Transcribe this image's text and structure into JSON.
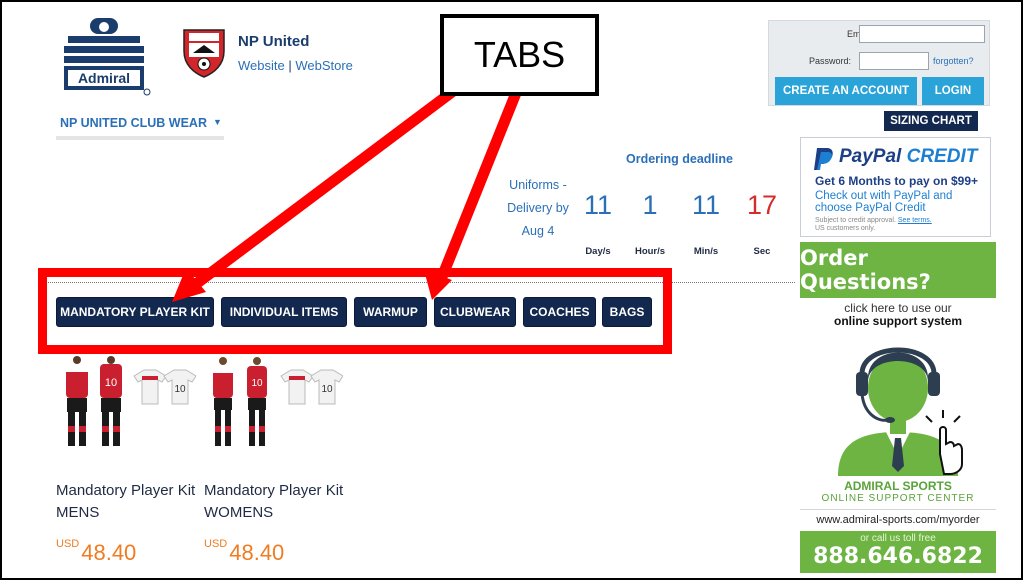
{
  "header": {
    "brand_logo_text": "Admiral",
    "club_name": "NP United",
    "link_website": "Website",
    "link_separator": " | ",
    "link_webstore": "WebStore",
    "club_menu_label": "NP UNITED CLUB WEAR"
  },
  "callout": {
    "label": "TABS",
    "color": "#ff0000"
  },
  "login": {
    "email_label": "Email:",
    "email_value": "",
    "password_label": "Password:",
    "password_value": "",
    "forgot_link": "forgotten?",
    "create_account_button": "CREATE AN ACCOUNT",
    "login_button": "LOGIN",
    "sizing_chart_button": "SIZING CHART"
  },
  "countdown": {
    "title": "Ordering deadline",
    "note": "Uniforms - Delivery by Aug 4",
    "days": "11",
    "hours": "1",
    "minutes": "11",
    "seconds": "17",
    "days_label": "Day/s",
    "hours_label": "Hour/s",
    "minutes_label": "Min/s",
    "seconds_label": "Sec"
  },
  "tabs": [
    {
      "label": "MANDATORY PLAYER KIT"
    },
    {
      "label": "INDIVIDUAL ITEMS"
    },
    {
      "label": "WARMUP"
    },
    {
      "label": "CLUBWEAR"
    },
    {
      "label": "COACHES"
    },
    {
      "label": "BAGS"
    }
  ],
  "products": [
    {
      "name": "Mandatory Player Kit MENS",
      "currency": "USD",
      "price": "48.40"
    },
    {
      "name": "Mandatory Player Kit WOMENS",
      "currency": "USD",
      "price": "48.40"
    }
  ],
  "paypal_banner": {
    "brand_word": "PayPal",
    "credit_word": "CREDIT",
    "headline": "Get 6 Months to pay on $99+",
    "line2": "Check out with PayPal and choose PayPal Credit",
    "fine_print_1": "Subject to credit approval.",
    "fine_print_link": "See terms.",
    "fine_print_2": "US customers only."
  },
  "support_banner": {
    "heading": "Order Questions?",
    "sub1": "click here to use our",
    "sub2": "online support system",
    "brand1": "ADMIRAL SPORTS",
    "brand2": "ONLINE SUPPORT CENTER",
    "url": "www.admiral-sports.com/myorder",
    "call_text": "or call us toll free",
    "phone": "888.646.6822"
  },
  "colors": {
    "navy": "#13284f",
    "link_blue": "#2a6fb8",
    "accent_cyan": "#2aa4d8",
    "price_orange": "#ef7c22",
    "timer_red": "#d42b2b",
    "support_green": "#6db443",
    "annotation_red": "#ff0000"
  }
}
